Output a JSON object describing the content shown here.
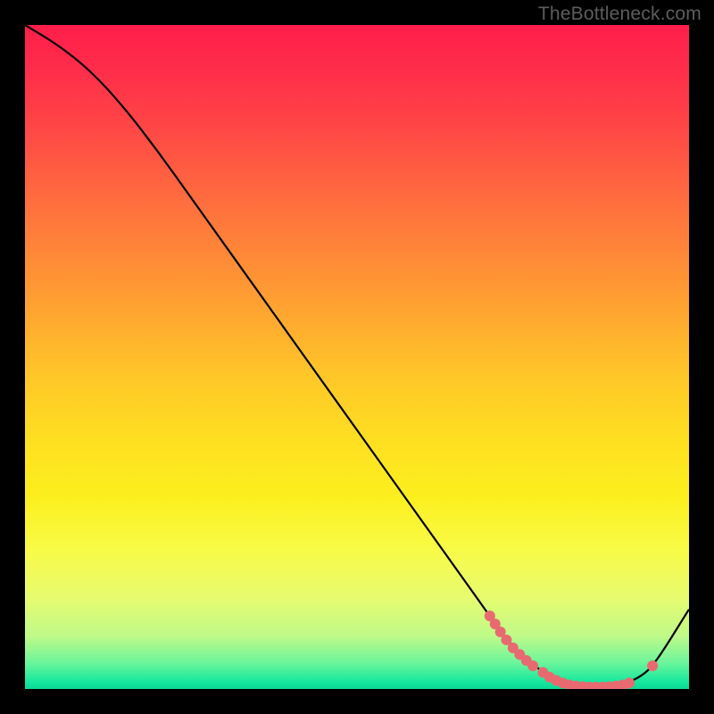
{
  "watermark": "TheBottleneck.com",
  "chart_data": {
    "type": "line",
    "title": "",
    "xlabel": "",
    "ylabel": "",
    "xlim": [
      0,
      100
    ],
    "ylim": [
      0,
      100
    ],
    "series": [
      {
        "name": "curve",
        "x": [
          0,
          5,
          10,
          15,
          20,
          25,
          30,
          35,
          40,
          45,
          50,
          55,
          60,
          65,
          70,
          72,
          75,
          78,
          80,
          82,
          85,
          88,
          90,
          93,
          95,
          100
        ],
        "y": [
          100,
          97,
          93,
          87.5,
          81,
          74,
          67,
          60,
          53,
          46,
          39,
          32,
          25,
          18,
          11,
          8,
          5,
          2.5,
          1.3,
          0.6,
          0.3,
          0.3,
          0.6,
          2,
          4,
          12
        ]
      }
    ],
    "dots": [
      {
        "x": 70.0,
        "y": 11.0
      },
      {
        "x": 70.8,
        "y": 9.8
      },
      {
        "x": 71.6,
        "y": 8.6
      },
      {
        "x": 72.5,
        "y": 7.4
      },
      {
        "x": 73.5,
        "y": 6.2
      },
      {
        "x": 74.5,
        "y": 5.2
      },
      {
        "x": 75.5,
        "y": 4.3
      },
      {
        "x": 76.5,
        "y": 3.5
      },
      {
        "x": 78.0,
        "y": 2.5
      },
      {
        "x": 79.0,
        "y": 1.8
      },
      {
        "x": 80.0,
        "y": 1.3
      },
      {
        "x": 81.0,
        "y": 0.9
      },
      {
        "x": 82.0,
        "y": 0.6
      },
      {
        "x": 83.0,
        "y": 0.45
      },
      {
        "x": 84.0,
        "y": 0.35
      },
      {
        "x": 85.0,
        "y": 0.3
      },
      {
        "x": 86.0,
        "y": 0.28
      },
      {
        "x": 87.0,
        "y": 0.3
      },
      {
        "x": 88.0,
        "y": 0.35
      },
      {
        "x": 89.0,
        "y": 0.45
      },
      {
        "x": 90.0,
        "y": 0.6
      },
      {
        "x": 91.0,
        "y": 0.9
      },
      {
        "x": 94.5,
        "y": 3.5
      }
    ],
    "gradient_stops": [
      {
        "pos": 0,
        "color": "#ff1e4a"
      },
      {
        "pos": 50,
        "color": "#fee020"
      },
      {
        "pos": 100,
        "color": "#0dd796"
      }
    ]
  }
}
